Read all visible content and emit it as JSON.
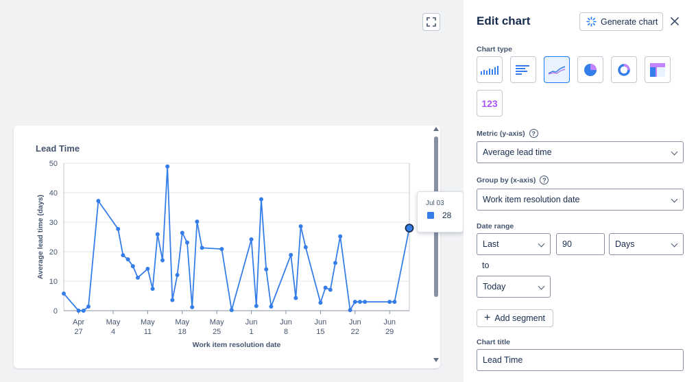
{
  "panel": {
    "title": "Edit chart",
    "generate_label": "Generate chart",
    "chart_type_label": "Chart type",
    "chart_types": [
      "vertical-bar-chart-icon",
      "horizontal-bar-chart-icon",
      "line-chart-icon",
      "pie-chart-icon",
      "donut-chart-icon",
      "heatmap-chart-icon",
      "number-chart-icon"
    ],
    "chart_type_selected": "line",
    "number_icon_text": "123",
    "metric_label": "Metric (y-axis)",
    "metric_value": "Average lead time",
    "groupby_label": "Group by (x-axis)",
    "groupby_value": "Work item resolution date",
    "date_range_label": "Date range",
    "date_range_mode": "Last",
    "date_range_amount": "90",
    "date_range_unit": "Days",
    "to_label": "to",
    "to_value": "Today",
    "add_segment_label": "Add segment",
    "chart_title_label": "Chart title",
    "chart_title_value": "Lead Time",
    "help_glyph": "?"
  },
  "tooltip": {
    "date": "Jul 03",
    "value": "28"
  },
  "colors": {
    "series": "#357de8",
    "selected_border": "#1d7afc",
    "selected_bg": "#e9f2ff"
  },
  "chart_data": {
    "type": "line",
    "title": "Lead Time",
    "xlabel": "Work item resolution date",
    "ylabel": "Average lead time (days)",
    "ylim": [
      0,
      50
    ],
    "yticks": [
      0,
      10,
      20,
      30,
      40,
      50
    ],
    "xlim": [
      "2025-04-24",
      "2025-07-03"
    ],
    "xticks": [
      {
        "date": "2025-04-27",
        "line1": "Apr",
        "line2": "27"
      },
      {
        "date": "2025-05-04",
        "line1": "May",
        "line2": "4"
      },
      {
        "date": "2025-05-11",
        "line1": "May",
        "line2": "11"
      },
      {
        "date": "2025-05-18",
        "line1": "May",
        "line2": "18"
      },
      {
        "date": "2025-05-25",
        "line1": "May",
        "line2": "25"
      },
      {
        "date": "2025-06-01",
        "line1": "Jun",
        "line2": "1"
      },
      {
        "date": "2025-06-08",
        "line1": "Jun",
        "line2": "8"
      },
      {
        "date": "2025-06-15",
        "line1": "Jun",
        "line2": "15"
      },
      {
        "date": "2025-06-22",
        "line1": "Jun",
        "line2": "22"
      },
      {
        "date": "2025-06-29",
        "line1": "Jun",
        "line2": "29"
      }
    ],
    "grid": true,
    "series": [
      {
        "x": [
          "2025-04-24",
          "2025-04-27",
          "2025-04-28",
          "2025-04-29",
          "2025-05-01",
          "2025-05-05",
          "2025-05-06",
          "2025-05-07",
          "2025-05-08",
          "2025-05-09",
          "2025-05-11",
          "2025-05-12",
          "2025-05-13",
          "2025-05-14",
          "2025-05-15",
          "2025-05-16",
          "2025-05-17",
          "2025-05-18",
          "2025-05-19",
          "2025-05-20",
          "2025-05-21",
          "2025-05-22",
          "2025-05-26",
          "2025-05-28",
          "2025-06-01",
          "2025-06-02",
          "2025-06-03",
          "2025-06-04",
          "2025-06-05",
          "2025-06-09",
          "2025-06-10",
          "2025-06-11",
          "2025-06-12",
          "2025-06-15",
          "2025-06-16",
          "2025-06-17",
          "2025-06-18",
          "2025-06-19",
          "2025-06-21",
          "2025-06-22",
          "2025-06-23",
          "2025-06-24",
          "2025-06-29",
          "2025-06-30",
          "2025-07-03"
        ],
        "y": [
          5.8,
          0,
          0,
          1.4,
          37.2,
          27.7,
          18.8,
          17.4,
          15.1,
          11.2,
          14.2,
          7.4,
          25.9,
          17.1,
          48.9,
          3.6,
          12.1,
          26.4,
          23.1,
          1.2,
          30.2,
          21.3,
          20.9,
          0.2,
          24.2,
          1.6,
          37.8,
          14.0,
          1.4,
          18.9,
          4.3,
          28.6,
          21.5,
          2.7,
          7.8,
          7.1,
          16.2,
          25.2,
          0.2,
          3.0,
          3.0,
          3.0,
          3.0,
          3.0,
          28.0
        ]
      }
    ]
  }
}
